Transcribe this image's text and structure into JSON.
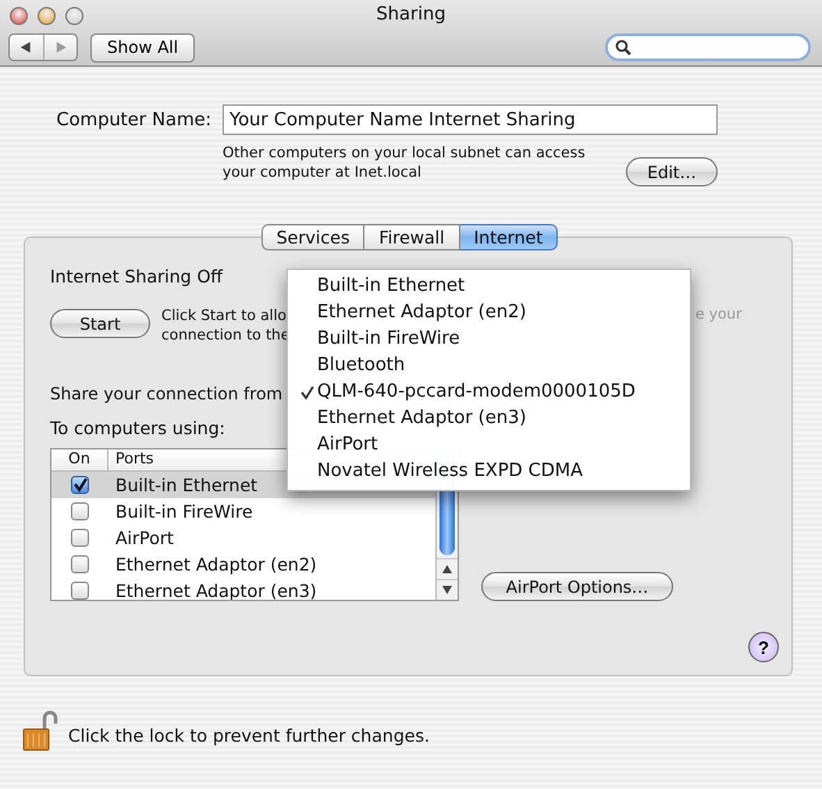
{
  "window": {
    "title": "Sharing"
  },
  "toolbar": {
    "show_all": "Show All"
  },
  "computer_name": {
    "label": "Computer Name:",
    "value": "Your Computer Name Internet Sharing",
    "note_lines": [
      "Other computers on your local subnet can access",
      "your computer at Inet.local"
    ],
    "edit_button": "Edit…"
  },
  "tabs": [
    {
      "label": "Services",
      "selected": false
    },
    {
      "label": "Firewall",
      "selected": false
    },
    {
      "label": "Internet",
      "selected": true
    }
  ],
  "internet": {
    "status": "Internet Sharing Off",
    "start_button": "Start",
    "description_lines": [
      "Click Start to allo",
      "connection to the"
    ],
    "description_fragment": "e your",
    "share_from_label": "Share your connection from",
    "to_computers_label": "To computers using:",
    "columns": [
      "On",
      "Ports"
    ],
    "ports": [
      {
        "name": "Built-in Ethernet",
        "checked": true,
        "selected": true
      },
      {
        "name": "Built-in FireWire",
        "checked": false,
        "selected": false
      },
      {
        "name": "AirPort",
        "checked": false,
        "selected": false
      },
      {
        "name": "Ethernet Adaptor (en2)",
        "checked": false,
        "selected": false
      },
      {
        "name": "Ethernet Adaptor (en3)",
        "checked": false,
        "selected": false
      }
    ],
    "airport_options_button": "AirPort Options…"
  },
  "popup_menu": [
    {
      "label": "Built-in Ethernet",
      "checked": false
    },
    {
      "label": "Ethernet Adaptor (en2)",
      "checked": false
    },
    {
      "label": "Built-in FireWire",
      "checked": false
    },
    {
      "label": "Bluetooth",
      "checked": false
    },
    {
      "label": "QLM-640-pccard-modem0000105D",
      "checked": true
    },
    {
      "label": "Ethernet Adaptor (en3)",
      "checked": false
    },
    {
      "label": "AirPort",
      "checked": false
    },
    {
      "label": "Novatel Wireless EXPD CDMA",
      "checked": false
    }
  ],
  "help_button": "?",
  "lock": {
    "text": "Click the lock to prevent further changes."
  }
}
